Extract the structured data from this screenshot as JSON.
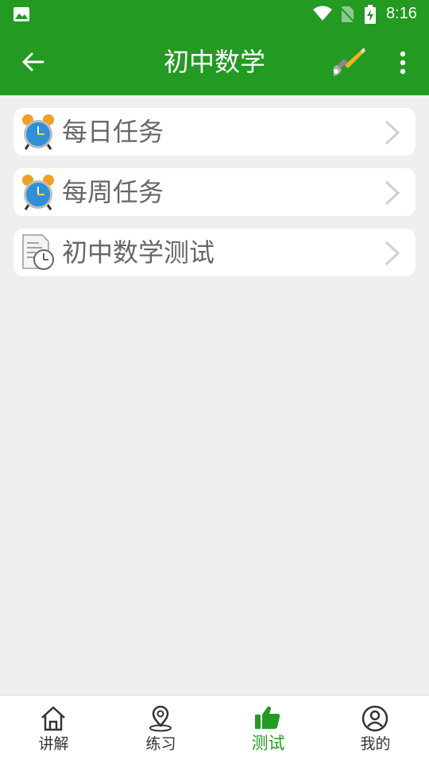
{
  "status_bar": {
    "time": "8:16"
  },
  "app_bar": {
    "title": "初中数学"
  },
  "menu": [
    {
      "label": "每日任务",
      "icon": "alarm-clock-icon"
    },
    {
      "label": "每周任务",
      "icon": "alarm-clock-icon"
    },
    {
      "label": "初中数学测试",
      "icon": "document-clock-icon"
    }
  ],
  "tabs": [
    {
      "label": "讲解",
      "icon": "home-icon"
    },
    {
      "label": "练习",
      "icon": "location-pin-icon"
    },
    {
      "label": "测试",
      "icon": "thumbs-up-icon",
      "active": true
    },
    {
      "label": "我的",
      "icon": "user-icon"
    }
  ],
  "colors": {
    "primary": "#239a22",
    "background": "#efefef",
    "text_muted": "#666666"
  }
}
